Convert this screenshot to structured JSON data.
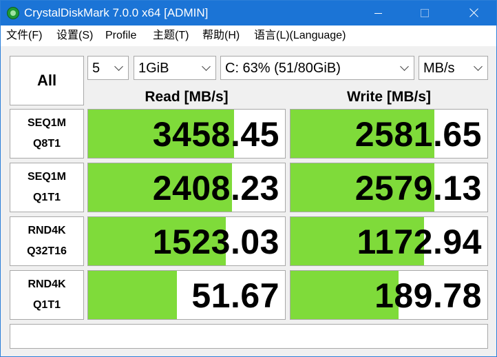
{
  "window": {
    "title": "CrystalDiskMark 7.0.0 x64 [ADMIN]"
  },
  "menu": [
    "文件(F)",
    "设置(S)",
    "Profile",
    "主题(T)",
    "帮助(H)",
    "语言(L)(Language)"
  ],
  "controls": {
    "all_label": "All",
    "count": "5",
    "size": "1GiB",
    "drive": "C: 63% (51/80GiB)",
    "unit": "MB/s"
  },
  "headers": {
    "read": "Read [MB/s]",
    "write": "Write [MB/s]"
  },
  "tests": [
    {
      "line1": "SEQ1M",
      "line2": "Q8T1",
      "read": "3458.45",
      "write": "2581.65",
      "read_fill": 0.74,
      "write_fill": 0.73
    },
    {
      "line1": "SEQ1M",
      "line2": "Q1T1",
      "read": "2408.23",
      "write": "2579.13",
      "read_fill": 0.73,
      "write_fill": 0.73
    },
    {
      "line1": "RND4K",
      "line2": "Q32T16",
      "read": "1523.03",
      "write": "1172.94",
      "read_fill": 0.7,
      "write_fill": 0.68
    },
    {
      "line1": "RND4K",
      "line2": "Q1T1",
      "read": "51.67",
      "write": "189.78",
      "read_fill": 0.45,
      "write_fill": 0.55
    }
  ],
  "colors": {
    "titlebar": "#1b74d6",
    "bar_fill": "#7fdb3a"
  },
  "comment": ""
}
